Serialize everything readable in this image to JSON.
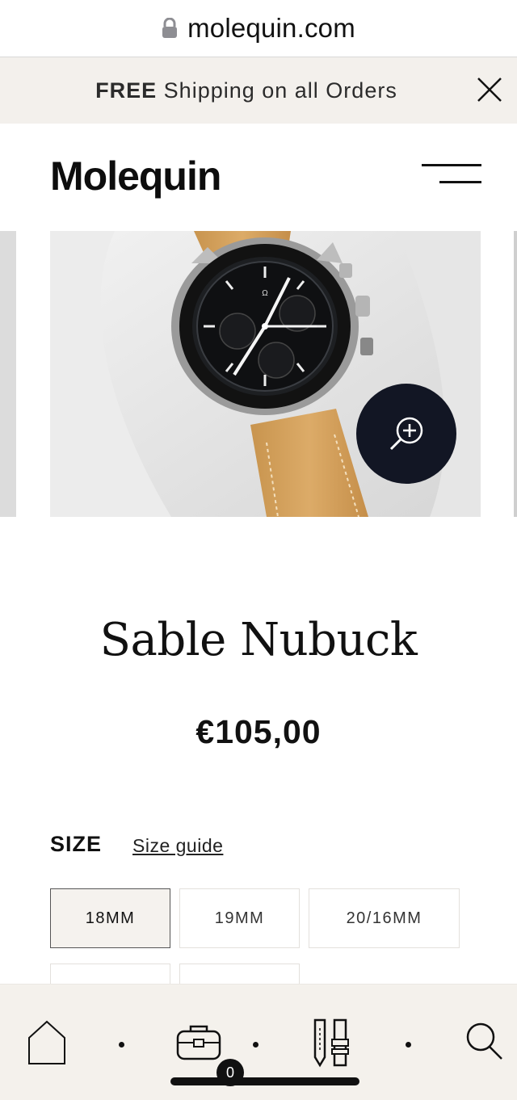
{
  "browser": {
    "url": "molequin.com"
  },
  "promo": {
    "bold": "FREE",
    "text": " Shipping on all Orders"
  },
  "header": {
    "logo": "Molequin"
  },
  "product": {
    "name": "Sable Nubuck",
    "price": "€105,00",
    "image_alt": "Omega Speedmaster watch on Sable Nubuck leather strap"
  },
  "size": {
    "label": "SIZE",
    "guide": "Size guide",
    "options": [
      "18MM",
      "19MM",
      "20/16MM"
    ],
    "selected": "18MM"
  },
  "bottom_nav": {
    "cart_count": "0"
  },
  "colors": {
    "promo_bg": "#f3f0ec",
    "zoom_button": "#121624",
    "strap": "#d4a25e",
    "nav_bg": "#f4f1ec"
  }
}
